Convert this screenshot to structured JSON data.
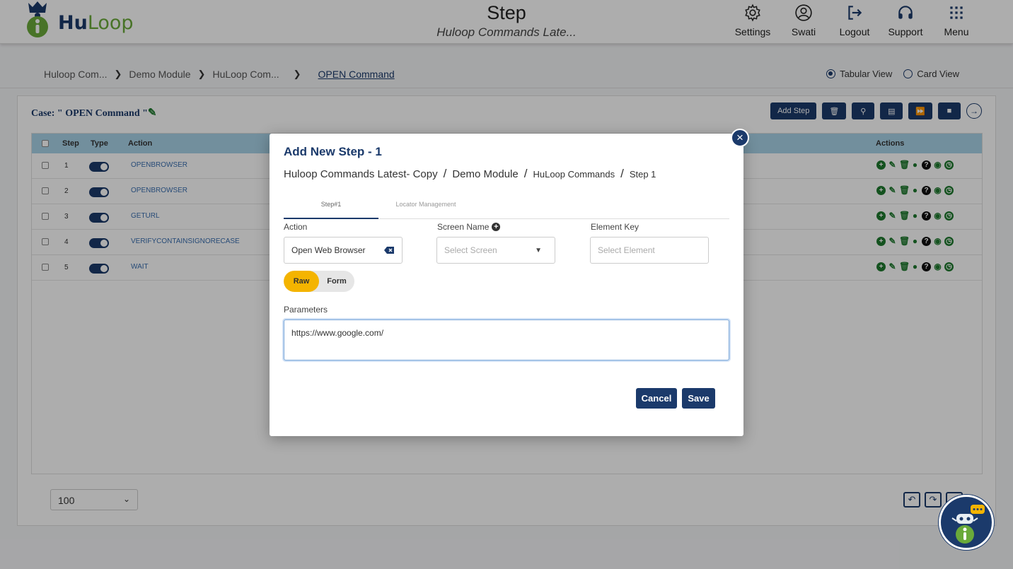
{
  "header": {
    "logo_hu": "Hu",
    "logo_loop": "Loop",
    "title": "Step",
    "subtitle": "Huloop Commands Late...",
    "nav": [
      {
        "label": "Settings",
        "icon": "gear-icon"
      },
      {
        "label": "Swati",
        "icon": "user-icon"
      },
      {
        "label": "Logout",
        "icon": "logout-icon"
      },
      {
        "label": "Support",
        "icon": "headset-icon"
      },
      {
        "label": "Menu",
        "icon": "grid-icon"
      }
    ]
  },
  "breadcrumb": {
    "items": [
      "Huloop Com...",
      "Demo Module",
      "HuLoop Com..."
    ],
    "current": "OPEN Command"
  },
  "view_toggle": {
    "tabular": "Tabular View",
    "card": "Card View",
    "selected": "Tabular View"
  },
  "case": {
    "title": "Case: \" OPEN Command \""
  },
  "toolbar": {
    "add_step": "Add Step"
  },
  "table": {
    "headers": {
      "step": "Step",
      "type": "Type",
      "action": "Action",
      "actions": "Actions"
    },
    "rows": [
      {
        "step": "1",
        "action": "OPENBROWSER"
      },
      {
        "step": "2",
        "action": "OPENBROWSER"
      },
      {
        "step": "3",
        "action": "GETURL"
      },
      {
        "step": "4",
        "action": "VERIFYCONTAINSIGNORECASE"
      },
      {
        "step": "5",
        "action": "WAIT"
      }
    ]
  },
  "footer": {
    "page_size": "100"
  },
  "modal": {
    "title": "Add New Step - 1",
    "crumbs": [
      "Huloop Commands Latest- Copy",
      "Demo Module",
      "HuLoop Commands",
      "Step 1"
    ],
    "tabs": [
      "Step#1",
      "Locator Management"
    ],
    "action_label": "Action",
    "action_value": "Open Web Browser",
    "screen_label": "Screen Name",
    "screen_placeholder": "Select Screen",
    "element_label": "Element Key",
    "element_placeholder": "Select Element",
    "mode_raw": "Raw",
    "mode_form": "Form",
    "params_label": "Parameters",
    "params_value": "https://www.google.com/",
    "cancel": "Cancel",
    "save": "Save",
    "close": "×"
  },
  "colors": {
    "primary": "#1b3a6b",
    "accent_green": "#1e7a2e",
    "header_row": "#a9d3e8",
    "raw_active": "#f4b400"
  }
}
